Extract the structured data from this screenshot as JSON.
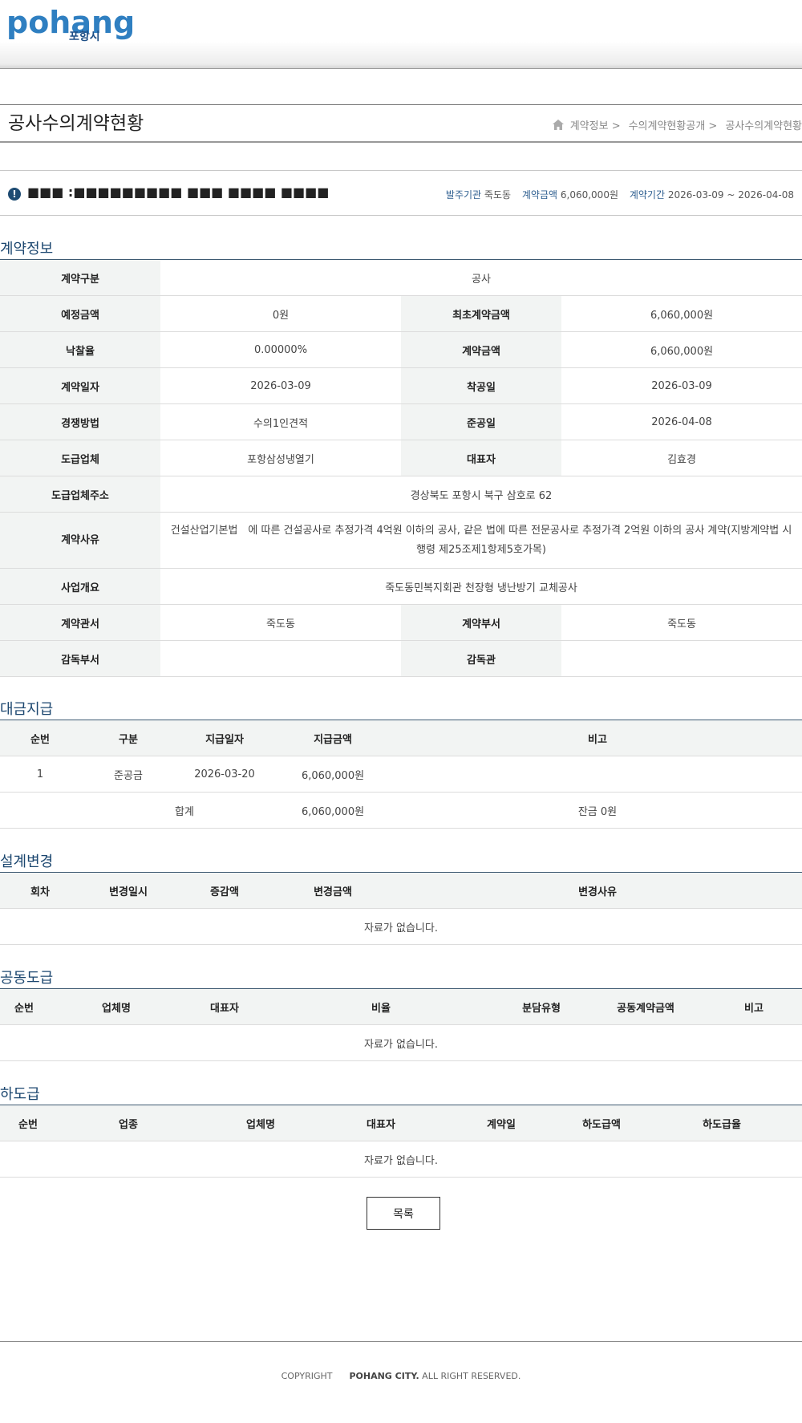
{
  "logo": {
    "main": "pohang",
    "sub": "포항시"
  },
  "page_title": "공사수의계약현황",
  "breadcrumb": [
    "계약정보 >",
    "수의계약현황공개 >",
    "공사수의계약현황"
  ],
  "info": {
    "subject": "■■■ :■■■■■■■■■ ■■■ ■■■■ ■■■■",
    "orderer_label": "발주기관",
    "orderer": "죽도동",
    "amount_label": "계약금액",
    "amount": "6,060,000원",
    "period_label": "계약기간",
    "period": "2026-03-09 ~ 2026-04-08"
  },
  "contract": {
    "section_title": "계약정보",
    "type_label": "계약구분",
    "type": "공사",
    "est_label": "예정금액",
    "est": "0원",
    "first_amount_label": "최초계약금액",
    "first_amount": "6,060,000원",
    "rate_label": "낙찰율",
    "rate": "0.00000%",
    "amount_label": "계약금액",
    "amount": "6,060,000원",
    "date_label": "계약일자",
    "date": "2026-03-09",
    "start_label": "착공일",
    "start": "2026-03-09",
    "method_label": "경쟁방법",
    "method": "수의1인견적",
    "end_label": "준공일",
    "end": "2026-04-08",
    "company_label": "도급업체",
    "company": "포항삼성냉열기",
    "ceo_label": "대표자",
    "ceo": "김효경",
    "address_label": "도급업체주소",
    "address": "경상북도 포항시 북구 삼호로 62",
    "reason_label": "계약사유",
    "reason": "건설산업기본법　에 따른 건설공사로 추정가격 4억원 이하의 공사, 같은 법에 따른 전문공사로 추정가격 2억원 이하의 공사 계약(지방계약법 시행령 제25조제1항제5호가목)",
    "summary_label": "사업개요",
    "summary": "죽도동민복지회관 천장형 냉난방기 교체공사",
    "office_label": "계약관서",
    "office": "죽도동",
    "dept_label": "계약부서",
    "dept": "죽도동",
    "supervise_dept_label": "감독부서",
    "supervise_dept": "",
    "supervisor_label": "감독관",
    "supervisor": ""
  },
  "payment": {
    "section_title": "대금지급",
    "headers": [
      "순번",
      "구분",
      "지급일자",
      "지급금액",
      "비고"
    ],
    "rows": [
      [
        "1",
        "준공금",
        "2026-03-20",
        "6,060,000원",
        ""
      ]
    ],
    "total_label": "합계",
    "total_amount": "6,060,000원",
    "balance": "잔금 0원"
  },
  "design_change": {
    "section_title": "설계변경",
    "headers": [
      "회차",
      "변경일시",
      "증감액",
      "변경금액",
      "변경사유"
    ],
    "empty": "자료가 없습니다."
  },
  "joint": {
    "section_title": "공동도급",
    "headers": [
      "순번",
      "업체명",
      "대표자",
      "비율",
      "분담유형",
      "공동계약금액",
      "비고"
    ],
    "empty": "자료가 없습니다."
  },
  "subcontract": {
    "section_title": "하도급",
    "headers": [
      "순번",
      "업종",
      "업체명",
      "대표자",
      "계약일",
      "하도급액",
      "하도급율"
    ],
    "empty": "자료가 없습니다."
  },
  "list_button": "목록",
  "footer": {
    "copyright": "COPYRIGHT",
    "owner": "POHANG CITY.",
    "rights": "ALL RIGHT RESERVED."
  },
  "colors": {
    "section_title": "#1b466f",
    "header_bg": "#f2f4f3",
    "logo_blue": "#2f7fc1"
  }
}
